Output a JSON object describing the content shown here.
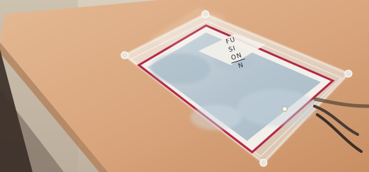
{
  "photo": {
    "subject": "tablet-in-acrylic-stand-on-table",
    "screen": {
      "logo": {
        "line1": "FU",
        "line2": "SI",
        "line3": "ON",
        "line4": "N"
      }
    },
    "icons": {
      "home_button": "home-button-icon"
    },
    "colors": {
      "wall": "#cfc2b3",
      "wall_shadow": "#5b4a3a",
      "table_top": "#d7a47c",
      "table_edge": "#b27c53",
      "tablet_border": "#b3284a",
      "screen_tint": "#b8c7d2",
      "logo_panel": "#f4f1ea",
      "acrylic": "#e9e4db"
    }
  }
}
